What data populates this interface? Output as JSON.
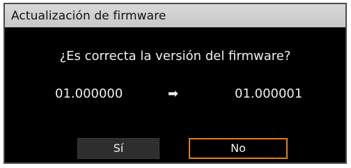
{
  "dialog": {
    "title": "Actualización de firmware",
    "question": "¿Es correcta la versión del firmware?",
    "current_version": "01.000000",
    "arrow_icon": "right-arrow-icon",
    "new_version": "01.000001",
    "buttons": {
      "yes_label": "Sí",
      "no_label": "No"
    },
    "colors": {
      "background": "#000000",
      "titlebar": "#cfcfcf",
      "text": "#f0f0f0",
      "focus_border": "#e0801a",
      "button_fill": "#2e2e2e"
    },
    "focused_button": "no"
  }
}
